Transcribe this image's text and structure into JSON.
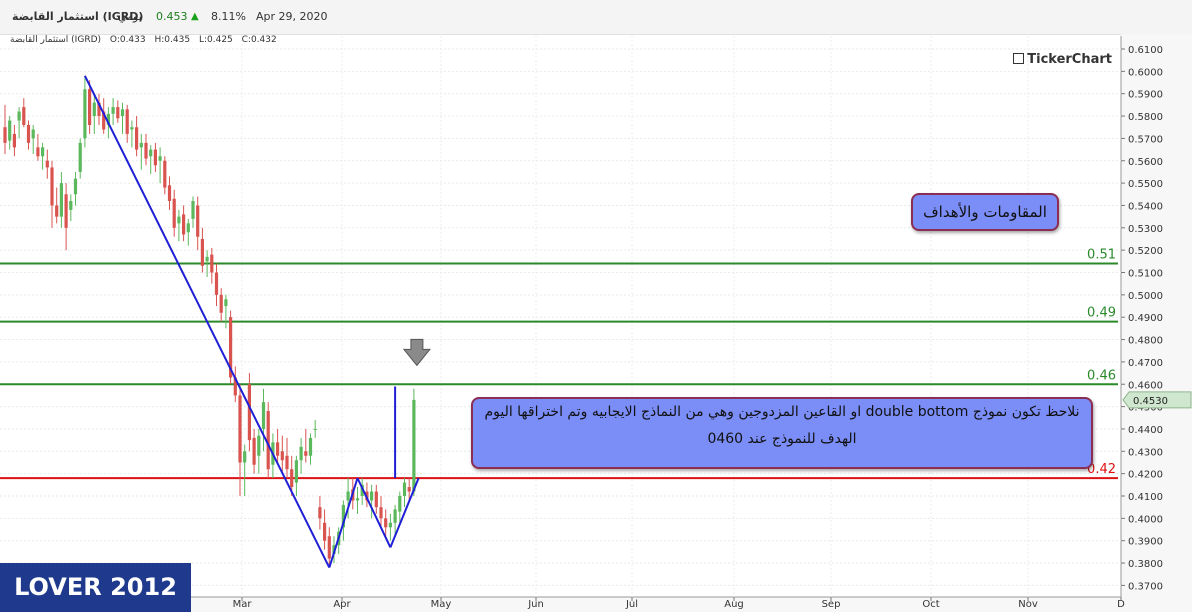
{
  "header": {
    "instrument_name": "استثمار القابضة (IGRD)",
    "timeframe": "يومي",
    "last_price": "0.453",
    "change_pct": "8.11%",
    "date": "Apr 29, 2020"
  },
  "ohlc": {
    "instrument_short": "استثمار القابضة (IGRD)",
    "open": "O:0.433",
    "high": "H:0.435",
    "low": "L:0.425",
    "close": "C:0.432"
  },
  "logo": "TickerChart",
  "watermark": "LOVER 2012",
  "annotations": {
    "title_box": "المقاومات والأهداف",
    "note_line1": "نلاحظ تكون نموذج double bottom او القاعين المزدوجين وهي من النماذج الايجابيه وتم اختراقها اليوم",
    "note_line2": "الهدف للنموذج عند 0460"
  },
  "chart_data": {
    "type": "candlestick",
    "y_axis_labels": [
      "0.6100",
      "0.6000",
      "0.5900",
      "0.5800",
      "0.5700",
      "0.5600",
      "0.5500",
      "0.5400",
      "0.5300",
      "0.5200",
      "0.5100",
      "0.5000",
      "0.4900",
      "0.4800",
      "0.4700",
      "0.4600",
      "0.4500",
      "0.4400",
      "0.4300",
      "0.4200",
      "0.4100",
      "0.4000",
      "0.3900",
      "0.3800",
      "0.3700"
    ],
    "y_ticks": [
      0.61,
      0.6,
      0.59,
      0.58,
      0.57,
      0.56,
      0.55,
      0.54,
      0.53,
      0.52,
      0.51,
      0.5,
      0.49,
      0.48,
      0.47,
      0.46,
      0.45,
      0.44,
      0.43,
      0.42,
      0.41,
      0.4,
      0.39,
      0.38,
      0.37
    ],
    "x_labels": [
      "Mar",
      "Apr",
      "May",
      "Jun",
      "Jul",
      "Aug",
      "Sep",
      "Oct",
      "Nov",
      "D"
    ],
    "grid": true,
    "last_price_label": "0.4530",
    "last_price": 0.453,
    "levels": [
      {
        "value": 0.514,
        "label": "0.51",
        "color": "#2a8a2a"
      },
      {
        "value": 0.488,
        "label": "0.49",
        "color": "#2a8a2a"
      },
      {
        "value": 0.46,
        "label": "0.46",
        "color": "#2a8a2a"
      },
      {
        "value": 0.418,
        "label": "0.42",
        "color": "#dd1111"
      }
    ],
    "candles": [
      [
        0.575,
        0.585,
        0.563,
        0.568
      ],
      [
        0.569,
        0.58,
        0.565,
        0.578
      ],
      [
        0.572,
        0.576,
        0.562,
        0.566
      ],
      [
        0.578,
        0.584,
        0.57,
        0.582
      ],
      [
        0.584,
        0.588,
        0.575,
        0.576
      ],
      [
        0.576,
        0.578,
        0.565,
        0.568
      ],
      [
        0.57,
        0.576,
        0.563,
        0.574
      ],
      [
        0.566,
        0.572,
        0.56,
        0.562
      ],
      [
        0.562,
        0.568,
        0.556,
        0.566
      ],
      [
        0.56,
        0.565,
        0.552,
        0.557
      ],
      [
        0.557,
        0.56,
        0.53,
        0.54
      ],
      [
        0.54,
        0.548,
        0.532,
        0.535
      ],
      [
        0.535,
        0.555,
        0.53,
        0.55
      ],
      [
        0.545,
        0.55,
        0.52,
        0.53
      ],
      [
        0.538,
        0.545,
        0.533,
        0.542
      ],
      [
        0.545,
        0.555,
        0.54,
        0.552
      ],
      [
        0.555,
        0.57,
        0.552,
        0.568
      ],
      [
        0.57,
        0.598,
        0.566,
        0.592
      ],
      [
        0.592,
        0.596,
        0.572,
        0.576
      ],
      [
        0.58,
        0.59,
        0.572,
        0.586
      ],
      [
        0.586,
        0.59,
        0.576,
        0.58
      ],
      [
        0.582,
        0.588,
        0.572,
        0.574
      ],
      [
        0.576,
        0.584,
        0.57,
        0.581
      ],
      [
        0.581,
        0.588,
        0.576,
        0.584
      ],
      [
        0.584,
        0.587,
        0.577,
        0.579
      ],
      [
        0.58,
        0.586,
        0.572,
        0.583
      ],
      [
        0.583,
        0.585,
        0.568,
        0.572
      ],
      [
        0.574,
        0.578,
        0.566,
        0.575
      ],
      [
        0.575,
        0.58,
        0.562,
        0.565
      ],
      [
        0.566,
        0.572,
        0.556,
        0.568
      ],
      [
        0.568,
        0.572,
        0.558,
        0.561
      ],
      [
        0.562,
        0.567,
        0.554,
        0.565
      ],
      [
        0.565,
        0.568,
        0.555,
        0.558
      ],
      [
        0.56,
        0.566,
        0.55,
        0.562
      ],
      [
        0.56,
        0.562,
        0.545,
        0.548
      ],
      [
        0.549,
        0.553,
        0.538,
        0.542
      ],
      [
        0.543,
        0.547,
        0.526,
        0.53
      ],
      [
        0.532,
        0.538,
        0.524,
        0.535
      ],
      [
        0.536,
        0.54,
        0.524,
        0.527
      ],
      [
        0.528,
        0.534,
        0.522,
        0.532
      ],
      [
        0.534,
        0.544,
        0.53,
        0.542
      ],
      [
        0.54,
        0.544,
        0.52,
        0.526
      ],
      [
        0.525,
        0.53,
        0.51,
        0.513
      ],
      [
        0.515,
        0.52,
        0.508,
        0.517
      ],
      [
        0.518,
        0.521,
        0.505,
        0.51
      ],
      [
        0.51,
        0.514,
        0.495,
        0.5
      ],
      [
        0.5,
        0.503,
        0.488,
        0.492
      ],
      [
        0.495,
        0.5,
        0.485,
        0.498
      ],
      [
        0.49,
        0.493,
        0.46,
        0.463
      ],
      [
        0.463,
        0.468,
        0.452,
        0.455
      ],
      [
        0.455,
        0.46,
        0.41,
        0.425
      ],
      [
        0.425,
        0.433,
        0.41,
        0.43
      ],
      [
        0.46,
        0.465,
        0.43,
        0.435
      ],
      [
        0.436,
        0.44,
        0.42,
        0.424
      ],
      [
        0.428,
        0.44,
        0.42,
        0.437
      ],
      [
        0.44,
        0.458,
        0.43,
        0.452
      ],
      [
        0.448,
        0.452,
        0.418,
        0.422
      ],
      [
        0.424,
        0.438,
        0.418,
        0.434
      ],
      [
        0.434,
        0.44,
        0.425,
        0.428
      ],
      [
        0.43,
        0.437,
        0.42,
        0.426
      ],
      [
        0.428,
        0.436,
        0.418,
        0.422
      ],
      [
        0.422,
        0.428,
        0.41,
        0.414
      ],
      [
        0.416,
        0.428,
        0.41,
        0.426
      ],
      [
        0.426,
        0.436,
        0.42,
        0.432
      ],
      [
        0.43,
        0.44,
        0.425,
        0.428
      ],
      [
        0.428,
        0.438,
        0.424,
        0.436
      ],
      [
        0.44,
        0.444,
        0.436,
        0.44
      ],
      [
        0.405,
        0.41,
        0.395,
        0.4
      ],
      [
        0.398,
        0.404,
        0.386,
        0.39
      ],
      [
        0.392,
        0.396,
        0.378,
        0.382
      ],
      [
        0.384,
        0.392,
        0.38,
        0.388
      ],
      [
        0.388,
        0.396,
        0.384,
        0.394
      ],
      [
        0.396,
        0.408,
        0.39,
        0.406
      ],
      [
        0.408,
        0.418,
        0.4,
        0.412
      ],
      [
        0.413,
        0.418,
        0.404,
        0.408
      ],
      [
        0.408,
        0.414,
        0.402,
        0.409
      ],
      [
        0.41,
        0.418,
        0.406,
        0.415
      ],
      [
        0.412,
        0.416,
        0.405,
        0.408
      ],
      [
        0.408,
        0.415,
        0.4,
        0.412
      ],
      [
        0.412,
        0.415,
        0.402,
        0.405
      ],
      [
        0.405,
        0.41,
        0.395,
        0.4
      ],
      [
        0.4,
        0.404,
        0.392,
        0.396
      ],
      [
        0.396,
        0.402,
        0.39,
        0.398
      ],
      [
        0.398,
        0.406,
        0.392,
        0.404
      ],
      [
        0.403,
        0.412,
        0.398,
        0.41
      ],
      [
        0.41,
        0.418,
        0.405,
        0.416
      ],
      [
        0.414,
        0.418,
        0.408,
        0.412
      ],
      [
        0.412,
        0.458,
        0.41,
        0.453
      ]
    ],
    "trendlines": [
      {
        "from": [
          0,
          0.598
        ],
        "to": [
          0,
          0.378
        ]
      },
      {
        "from": [
          0,
          0.378
        ],
        "to": [
          0,
          0.418
        ]
      },
      {
        "from": [
          0,
          0.418
        ],
        "to": [
          0,
          0.387
        ]
      },
      {
        "from": [
          0,
          0.387
        ],
        "to": [
          0,
          0.418
        ]
      },
      {
        "from": [
          0,
          0.418
        ],
        "to": [
          0,
          0.459
        ]
      }
    ]
  }
}
